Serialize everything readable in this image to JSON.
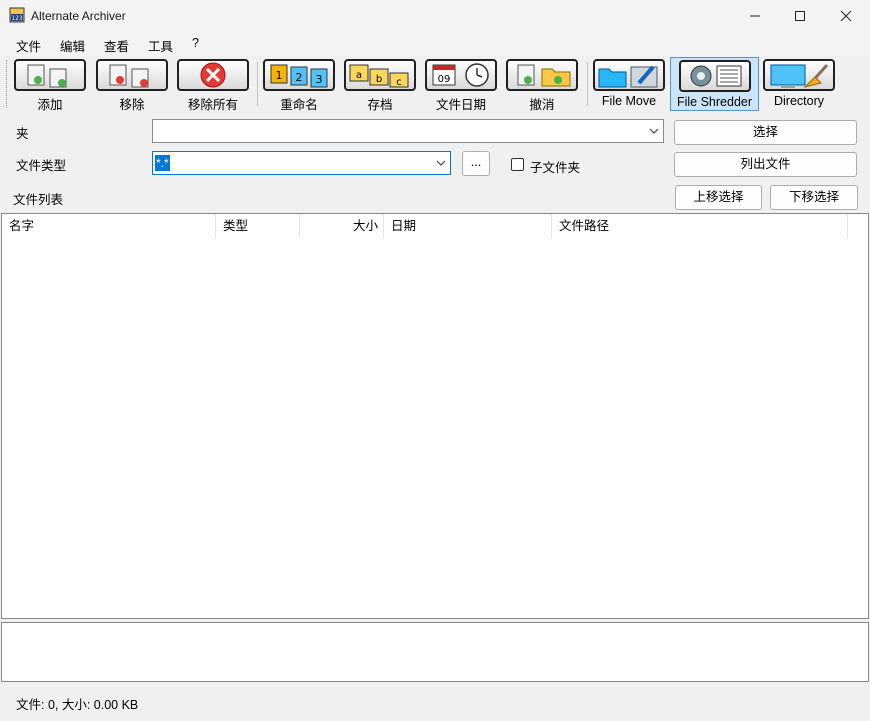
{
  "window": {
    "title": "Alternate Archiver",
    "icon": "app-123-icon"
  },
  "menu": [
    "文件",
    "编辑",
    "查看",
    "工具",
    "?"
  ],
  "toolbar": {
    "add": "添加",
    "remove": "移除",
    "remove_all": "移除所有",
    "rename": "重命名",
    "archive": "存档",
    "file_date": "文件日期",
    "undo": "撤消",
    "file_move": "File Move",
    "file_shredder": "File Shredder",
    "directory": "Directory"
  },
  "form": {
    "folder_label": "夹",
    "folder_value": "",
    "select_button": "选择",
    "filetype_label": "文件类型",
    "filetype_value": "*.*",
    "browse_button": "...",
    "subfolder_label": "子文件夹",
    "subfolder_checked": false,
    "list_files_button": "列出文件"
  },
  "file_list": {
    "label": "文件列表",
    "move_up_button": "上移选择",
    "move_down_button": "下移选择",
    "columns": [
      "名字",
      "类型",
      "大小",
      "日期",
      "文件路径"
    ],
    "rows": []
  },
  "status": {
    "text": "文件: 0, 大小: 0.00 KB"
  },
  "colors": {
    "selection": "#0078d7",
    "selected_tool_bg": "#cce4f7"
  }
}
